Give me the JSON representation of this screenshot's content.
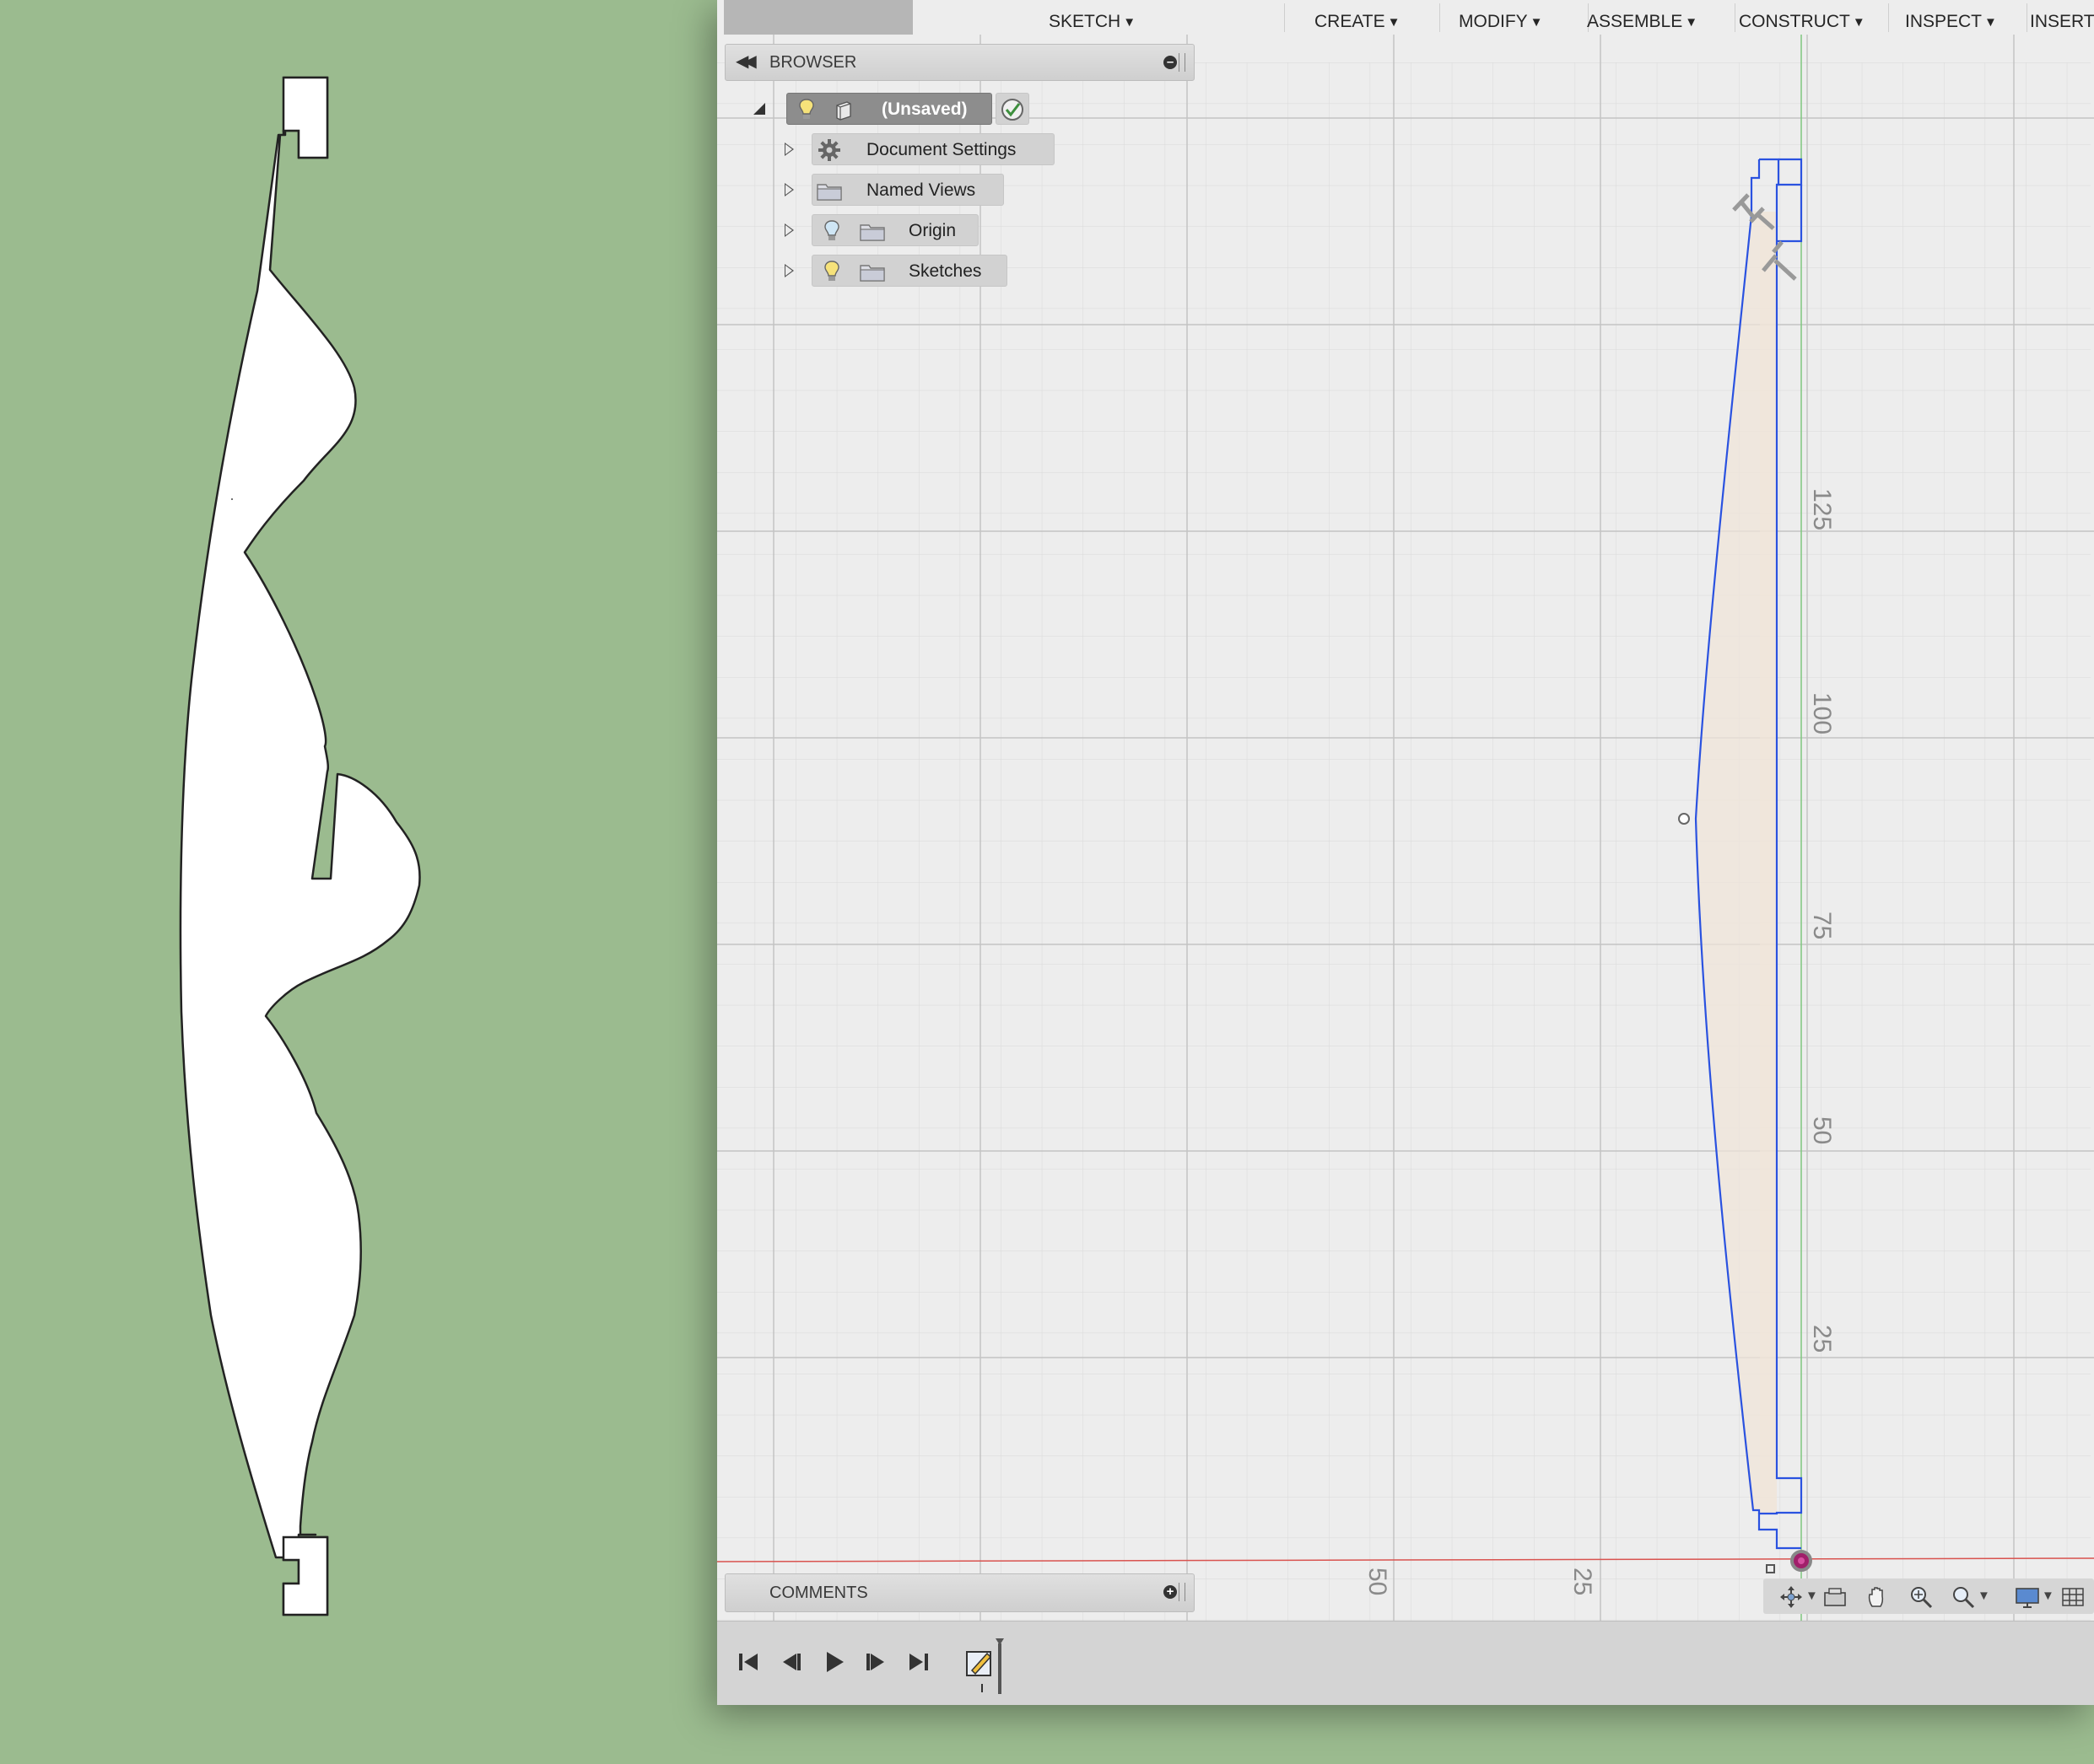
{
  "toolbar": {
    "menus": [
      {
        "label": "SKETCH"
      },
      {
        "label": "CREATE"
      },
      {
        "label": "MODIFY"
      },
      {
        "label": "ASSEMBLE"
      },
      {
        "label": "CONSTRUCT"
      },
      {
        "label": "INSPECT"
      },
      {
        "label": "INSERT"
      }
    ]
  },
  "browser": {
    "title": "BROWSER",
    "root": {
      "label": "(Unsaved)"
    },
    "items": [
      {
        "label": "Document Settings",
        "icon": "gear-icon"
      },
      {
        "label": "Named Views",
        "icon": "folder-icon"
      },
      {
        "label": "Origin",
        "icon": "folder-icon"
      },
      {
        "label": "Sketches",
        "icon": "folder-icon"
      }
    ]
  },
  "comments": {
    "title": "COMMENTS"
  },
  "canvas": {
    "vertical_ruler": [
      "125",
      "100",
      "75",
      "50",
      "25"
    ],
    "horizontal_ruler": [
      "50",
      "25"
    ],
    "colors": {
      "sketch_line": "#2a52e0",
      "profile_fill": "#efe4d8",
      "x_axis": "#d9534f",
      "y_axis": "#7fc77f",
      "origin": "#a0206a"
    }
  },
  "nav_bar": {
    "tools": [
      "orbit-icon",
      "look-at-icon",
      "pan-icon",
      "zoom-icon",
      "zoom-window-icon",
      "display-settings-icon"
    ]
  },
  "timeline": {
    "controls": [
      "first-icon",
      "previous-icon",
      "play-icon",
      "next-icon",
      "last-icon"
    ],
    "items": [
      "sketch-feature-icon"
    ]
  },
  "colors": {
    "desktop_green": "#9bbb8f",
    "cutout_fill": "#ffffff"
  }
}
